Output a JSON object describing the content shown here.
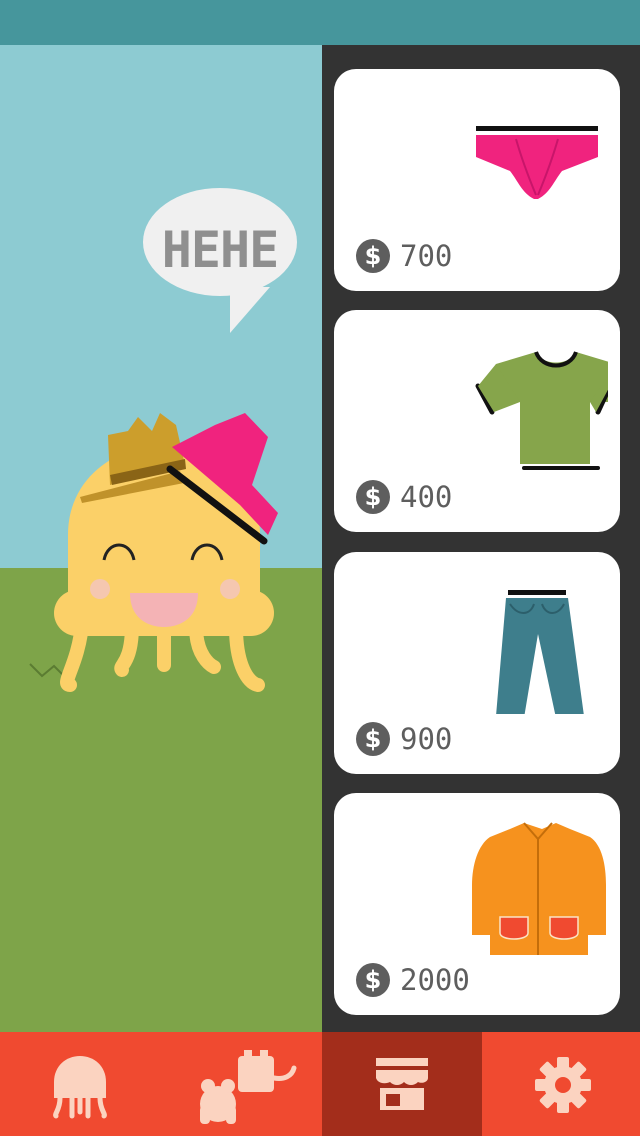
{
  "scene": {
    "speech_text": "HEHE",
    "pet_icon": "jellyfish-pet",
    "wearing": [
      "straw-hat-icon",
      "pink-underwear-icon"
    ]
  },
  "shop": {
    "items": [
      {
        "icon": "pink-briefs-icon",
        "price": "700"
      },
      {
        "icon": "green-tshirt-icon",
        "price": "400"
      },
      {
        "icon": "blue-jeans-icon",
        "price": "900"
      },
      {
        "icon": "orange-jacket-icon",
        "price": "2000"
      }
    ],
    "currency_symbol": "$"
  },
  "tabs": [
    {
      "name": "pet",
      "icon": "jellyfish-icon"
    },
    {
      "name": "friends",
      "icon": "friends-icon"
    },
    {
      "name": "shop",
      "icon": "shop-icon",
      "active": true
    },
    {
      "name": "settings",
      "icon": "gear-icon"
    }
  ],
  "colors": {
    "status_bar": "#46969c",
    "sky": "#8dcbd2",
    "grass": "#7ea449",
    "tabbar": "#f04a30",
    "tab_active": "#a32d1b",
    "pet_body": "#fbd068"
  }
}
